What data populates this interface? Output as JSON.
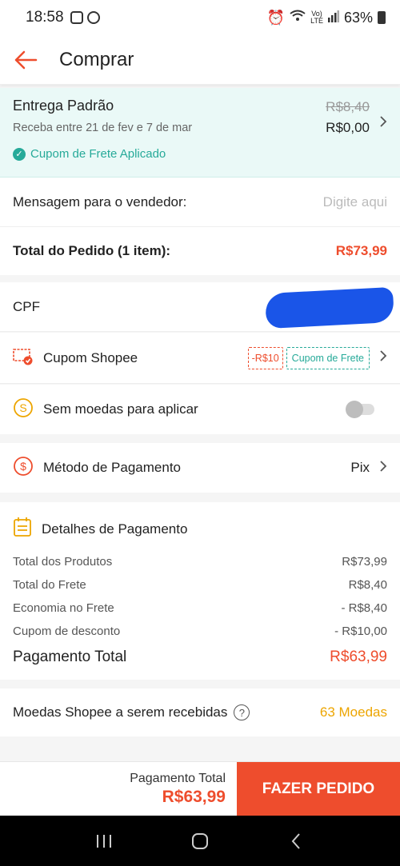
{
  "status": {
    "time": "18:58",
    "battery": "63%"
  },
  "appbar": {
    "title": "Comprar"
  },
  "delivery": {
    "title": "Entrega Padrão",
    "window": "Receba entre 21 de fev e 7 de mar",
    "old_price": "R$8,40",
    "new_price": "R$0,00",
    "coupon": "Cupom de Frete Aplicado"
  },
  "message": {
    "label": "Mensagem para o vendedor:",
    "placeholder": "Digite aqui"
  },
  "order_total": {
    "label": "Total do Pedido (1 item):",
    "value": "R$73,99"
  },
  "cpf": {
    "label": "CPF"
  },
  "shopee_coupon": {
    "label": "Cupom Shopee",
    "discount_tag": "-R$10",
    "shipping_tag": "Cupom de Frete"
  },
  "coins": {
    "label": "Sem moedas para aplicar",
    "toggle_on": false
  },
  "payment_method": {
    "label": "Método de Pagamento",
    "value": "Pix"
  },
  "payment_details": {
    "heading": "Detalhes de Pagamento",
    "rows": [
      {
        "label": "Total dos Produtos",
        "value": "R$73,99"
      },
      {
        "label": "Total do Frete",
        "value": "R$8,40"
      },
      {
        "label": "Economia no Frete",
        "value": "- R$8,40"
      },
      {
        "label": "Cupom de desconto",
        "value": "- R$10,00"
      }
    ],
    "total_label": "Pagamento Total",
    "total_value": "R$63,99"
  },
  "coins_earned": {
    "label": "Moedas Shopee a serem recebidas",
    "help": "?",
    "value": "63 Moedas"
  },
  "bottom": {
    "total_label": "Pagamento Total",
    "total_value": "R$63,99",
    "order_button": "FAZER PEDIDO"
  },
  "colors": {
    "accent": "#ee4d2d",
    "teal": "#26aa99",
    "coin": "#eda500"
  }
}
